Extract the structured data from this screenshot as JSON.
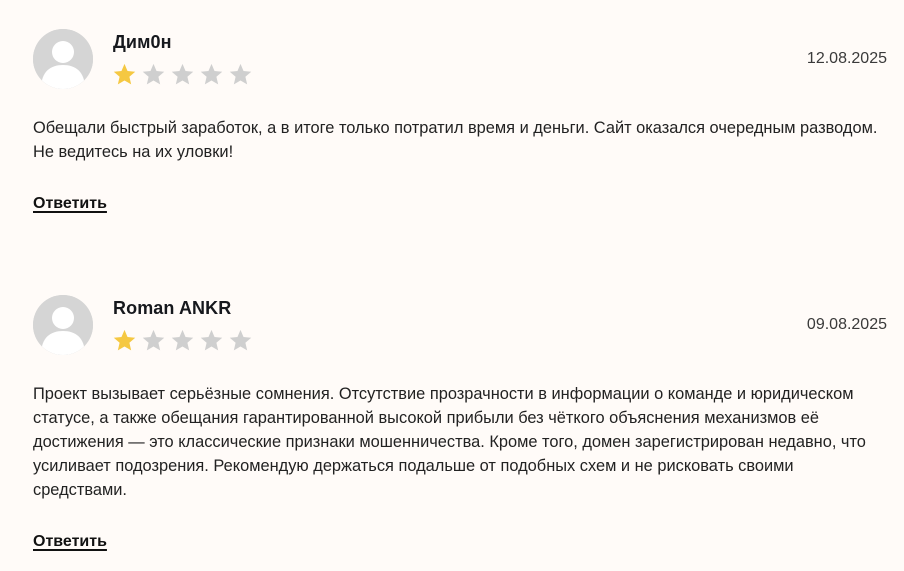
{
  "comments": [
    {
      "author": "Дим0н",
      "date": "12.08.2025",
      "rating": 1,
      "rating_max": 5,
      "text": "Обещали быстрый заработок, а в итоге только потратил время и деньги. Сайт оказался очередным разводом. Не ведитесь на их уловки!",
      "reply_label": "Ответить",
      "avatar_icon": "user-avatar-icon"
    },
    {
      "author": "Roman ANKR",
      "date": "09.08.2025",
      "rating": 1,
      "rating_max": 5,
      "text": "Проект вызывает серьёзные сомнения. Отсутствие прозрачности в информации о команде и юридическом статусе, а также обещания гарантированной высокой прибыли без чёткого объяснения механизмов её достижения — это классические признаки мошенничества. Кроме того, домен зарегистрирован недавно, что усиливает подозрения. Рекомендую держаться подальше от подобных схем и не рисковать своими средствами.",
      "reply_label": "Ответить",
      "avatar_icon": "user-avatar-icon"
    }
  ],
  "colors": {
    "background": "#fffbf8",
    "star_filled": "#f5c842",
    "star_empty": "#cfcfcf",
    "avatar_bg": "#d5d5d5"
  }
}
